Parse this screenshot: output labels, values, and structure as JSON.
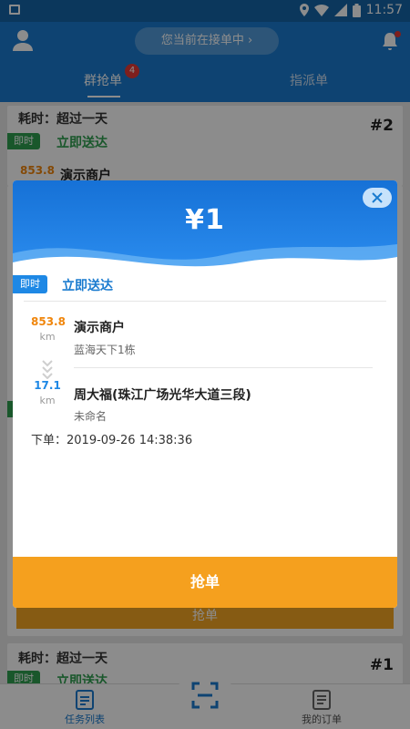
{
  "status_bar": {
    "time": "11:57"
  },
  "header": {
    "working_status": "您当前在接单中",
    "tabs": [
      {
        "label": "群抢单",
        "badge": "4",
        "active": true
      },
      {
        "label": "指派单",
        "active": false
      }
    ]
  },
  "background_list": {
    "card1": {
      "elapsed": "耗时：超过一天",
      "order_no": "#2",
      "tag": "即时",
      "delivery": "立即送达",
      "distance": "853.8",
      "merchant": "演示商户"
    },
    "card2": {
      "elapsed": "耗时：超过一天",
      "order_no": "#1",
      "tag": "即时",
      "delivery": "立即送达"
    },
    "grab_label": "抢单"
  },
  "modal": {
    "price": "¥1",
    "tag": "即时",
    "delivery": "立即送达",
    "pickup": {
      "distance": "853.8",
      "unit": "km",
      "name": "演示商户",
      "address": "蓝海天下1栋"
    },
    "dropoff": {
      "distance": "17.1",
      "unit": "km",
      "name": "周大福(珠江广场光华大道三段)",
      "address": "未命名"
    },
    "order_time_label": "下单：",
    "order_time": "2019-09-26 14:38:36",
    "grab_button": "抢单"
  },
  "bottom_nav": {
    "items": [
      {
        "label": "任务列表",
        "active": true
      },
      {
        "label": "我的订单",
        "active": false
      }
    ]
  },
  "colors": {
    "primary": "#1a7bcf",
    "accent_orange": "#f5a01e",
    "green": "#2e9e4f",
    "pickup_orange": "#f0860c",
    "dropoff_blue": "#1e88e5"
  }
}
